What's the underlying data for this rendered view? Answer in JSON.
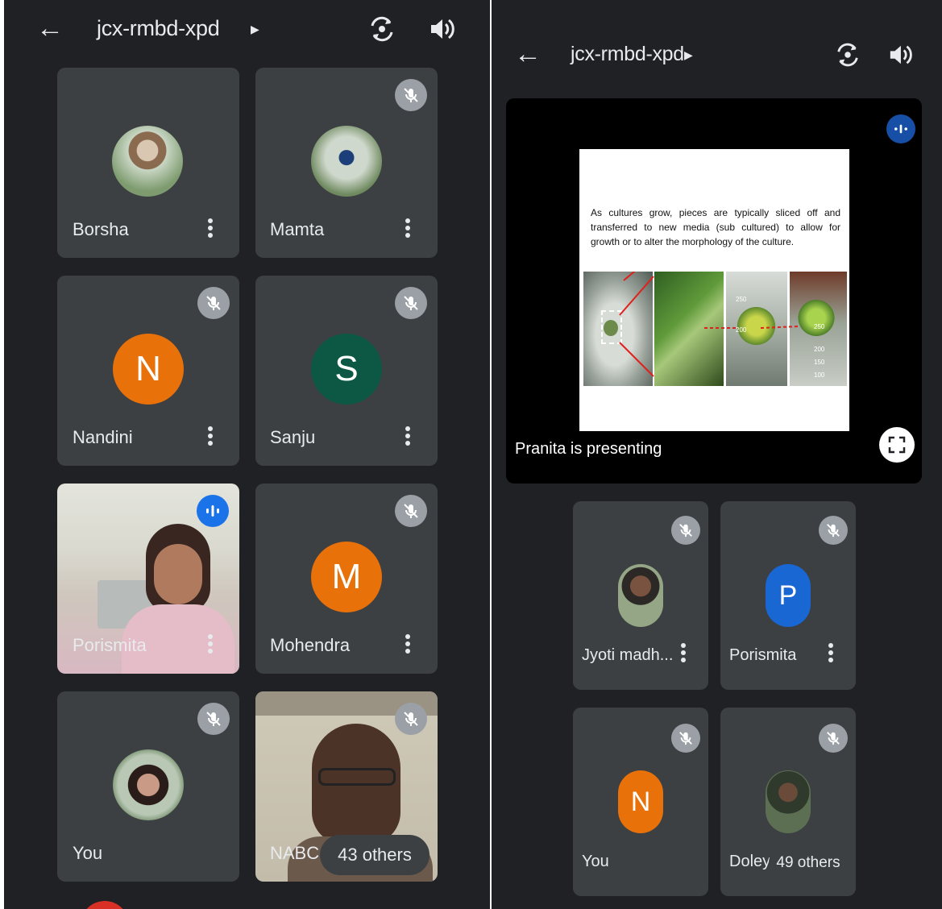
{
  "left": {
    "topbar": {
      "meeting_code": "jcx-rmbd-xpd"
    },
    "tiles": [
      {
        "name": "Borsha"
      },
      {
        "name": "Mamta"
      },
      {
        "name": "Nandini",
        "initial": "N"
      },
      {
        "name": "Sanju",
        "initial": "S"
      },
      {
        "name": "Porismita"
      },
      {
        "name": "Mohendra",
        "initial": "M"
      },
      {
        "name": "You"
      },
      {
        "name": "NABC",
        "others": "43 others"
      }
    ]
  },
  "right": {
    "topbar": {
      "meeting_code": "jcx-rmbd-xpd"
    },
    "presentation": {
      "slide_text": "As cultures grow, pieces are typically sliced off and transferred to new media (sub cultured) to allow for growth or to alter the morphology of the culture.",
      "presenting_label": "Pranita is presenting",
      "beaker_labels": [
        "250",
        "200",
        "250",
        "200",
        "150",
        "100"
      ]
    },
    "tiles": [
      {
        "name": "Jyoti madh..."
      },
      {
        "name": "Porismita",
        "initial": "P"
      },
      {
        "name": "You",
        "initial": "N"
      },
      {
        "name": "Doley",
        "others": "49 others"
      }
    ]
  },
  "colors": {
    "background": "#202124",
    "tile": "#3c4043",
    "text": "#e8eaed",
    "mic_off_badge": "#9aa0a6",
    "speaking_badge": "#1a73e8",
    "avatar_orange": "#e8710a",
    "avatar_green": "#0d5844",
    "avatar_blue": "#1967d2"
  }
}
